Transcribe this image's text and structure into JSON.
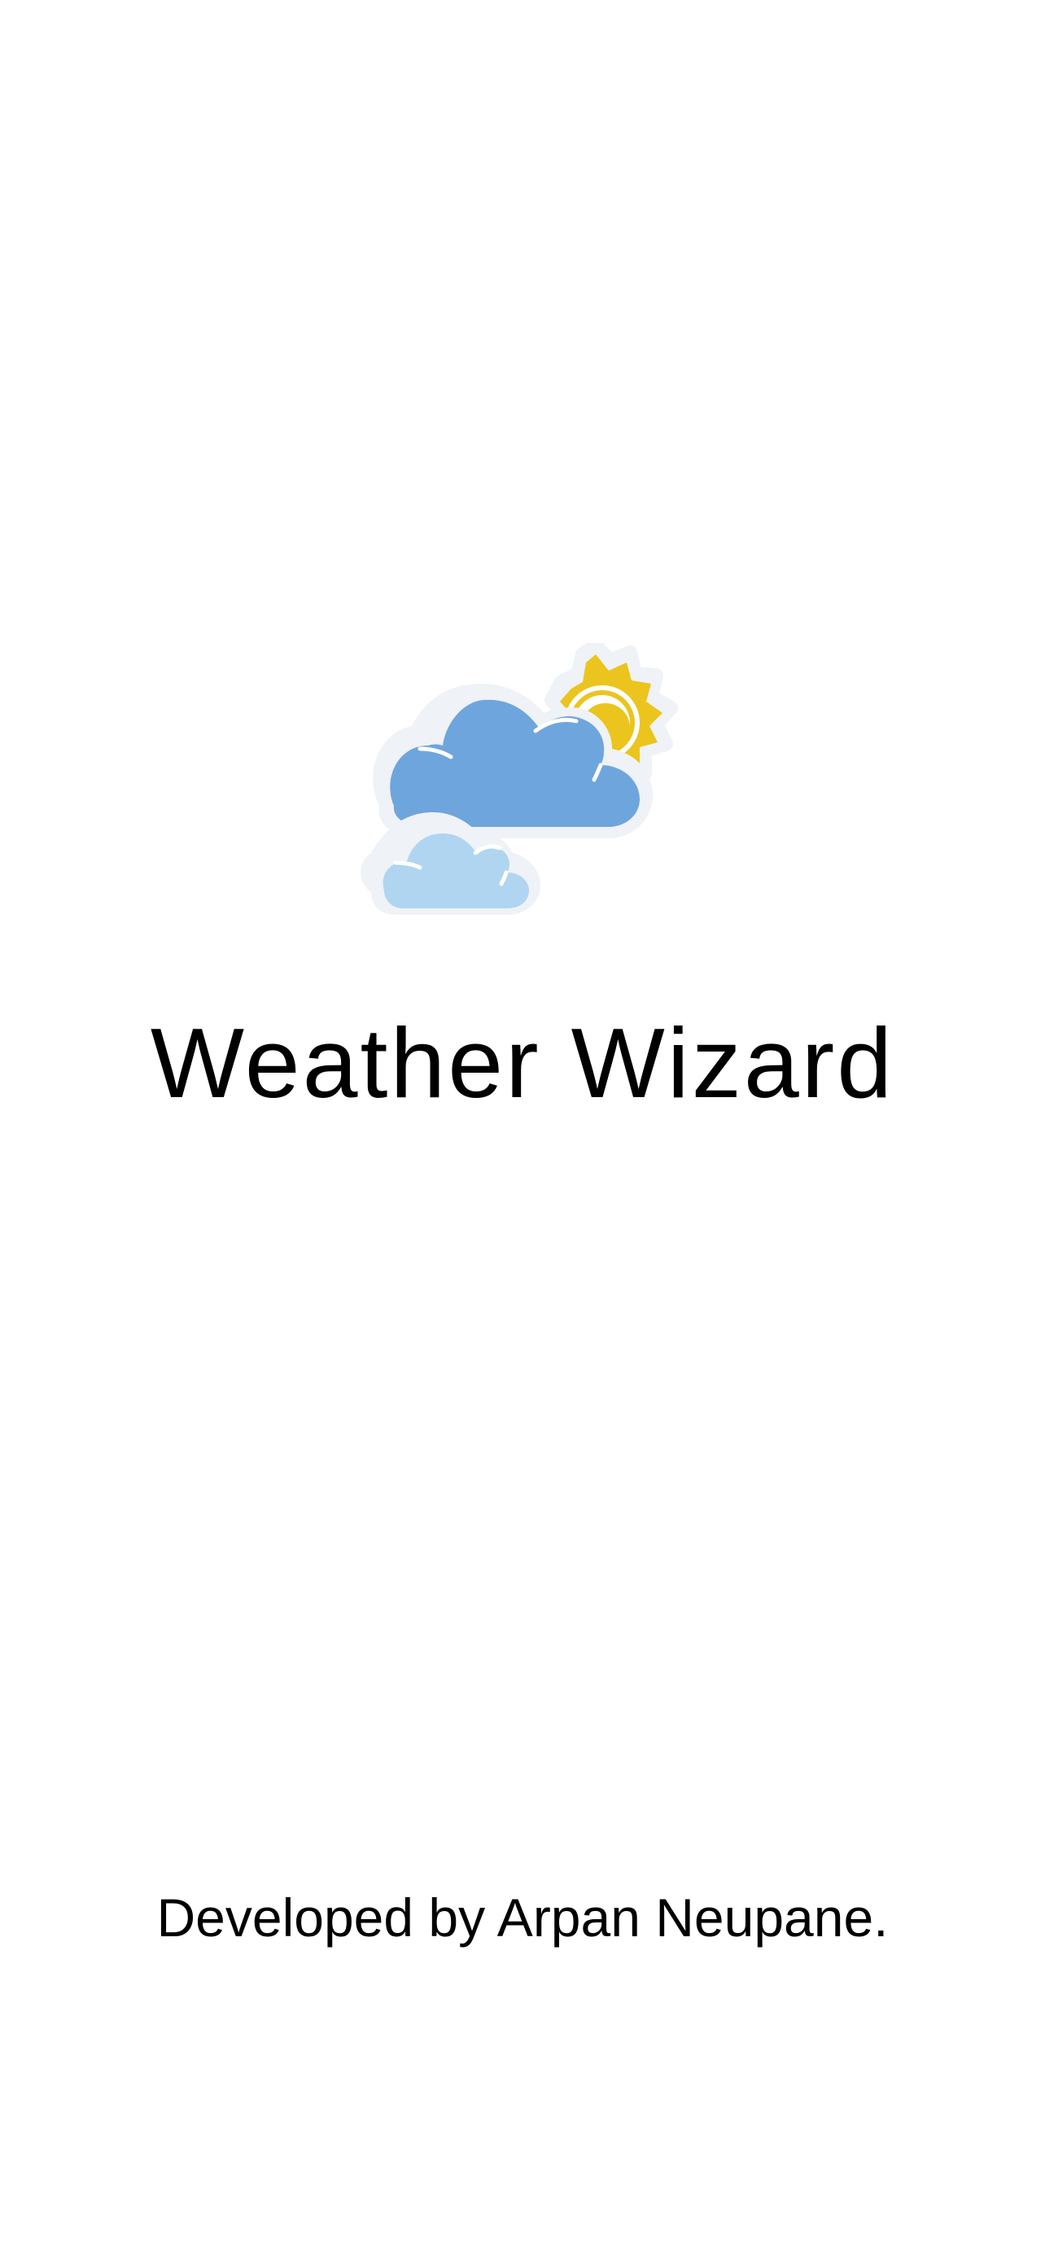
{
  "splash": {
    "logo_icon": "partly-cloudy-icon",
    "title": "Weather Wizard",
    "credit": "Developed by Arpan Neupane."
  },
  "colors": {
    "background": "#ffffff",
    "sun": "#ebc51d",
    "cloud_dark": "#6fa5dd",
    "cloud_light": "#afd5f1",
    "outline": "#eff2f6",
    "text": "#000000"
  }
}
